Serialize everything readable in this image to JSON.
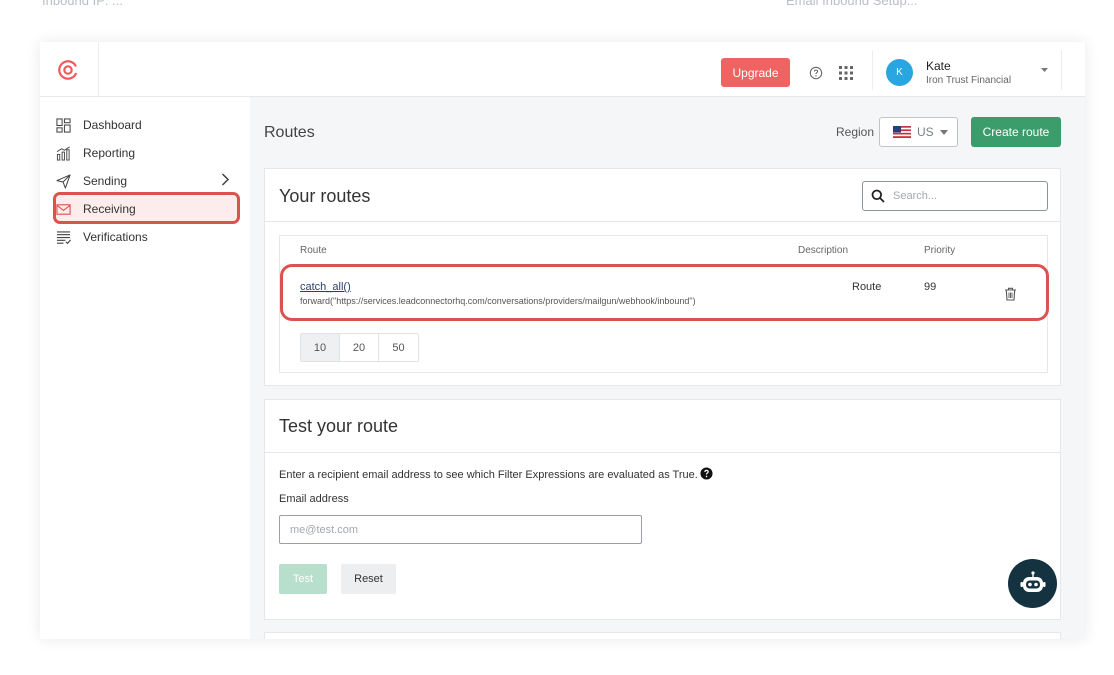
{
  "top_strip": {
    "left_text": "Inbound IP: ...",
    "right_text": "Email Inbound Setup..."
  },
  "header": {
    "logo_icon": "at-sign-icon",
    "upgrade_label": "Upgrade",
    "help_icon": "help-circle-icon",
    "apps_icon": "grid-icon",
    "user": {
      "initial": "K",
      "name": "Kate",
      "org": "Iron Trust Financial"
    }
  },
  "sidebar": {
    "items": [
      {
        "label": "Dashboard",
        "icon": "dashboard-icon"
      },
      {
        "label": "Reporting",
        "icon": "chart-icon"
      },
      {
        "label": "Sending",
        "icon": "send-icon"
      },
      {
        "label": "Receiving",
        "icon": "envelope-icon"
      },
      {
        "label": "Verifications",
        "icon": "list-check-icon"
      }
    ],
    "highlighted_color": "#d9534f"
  },
  "page": {
    "title": "Routes",
    "region_label": "Region",
    "region_value": "US",
    "create_label": "Create route"
  },
  "routes": {
    "title": "Your routes",
    "search_placeholder": "Search...",
    "columns": {
      "route": "Route",
      "description": "Description",
      "priority": "Priority"
    },
    "rows": [
      {
        "expression": "catch_all()",
        "action": "forward(\"https://services.leadconnectorhq.com/conversations/providers/mailgun/webhook/inbound\")",
        "description": "Route",
        "priority": "99"
      }
    ],
    "page_sizes": [
      "10",
      "20",
      "50"
    ],
    "selected_page_size": "10"
  },
  "test": {
    "title": "Test your route",
    "description": "Enter a recipient email address to see which Filter Expressions are evaluated as True.",
    "email_label": "Email address",
    "email_placeholder": "me@test.com",
    "test_label": "Test",
    "reset_label": "Reset"
  },
  "colors": {
    "upgrade": "#ef6363",
    "create": "#3b9d6b",
    "avatar": "#29a6e0",
    "chatbot": "#14323f",
    "annotation": "#d9534f"
  }
}
